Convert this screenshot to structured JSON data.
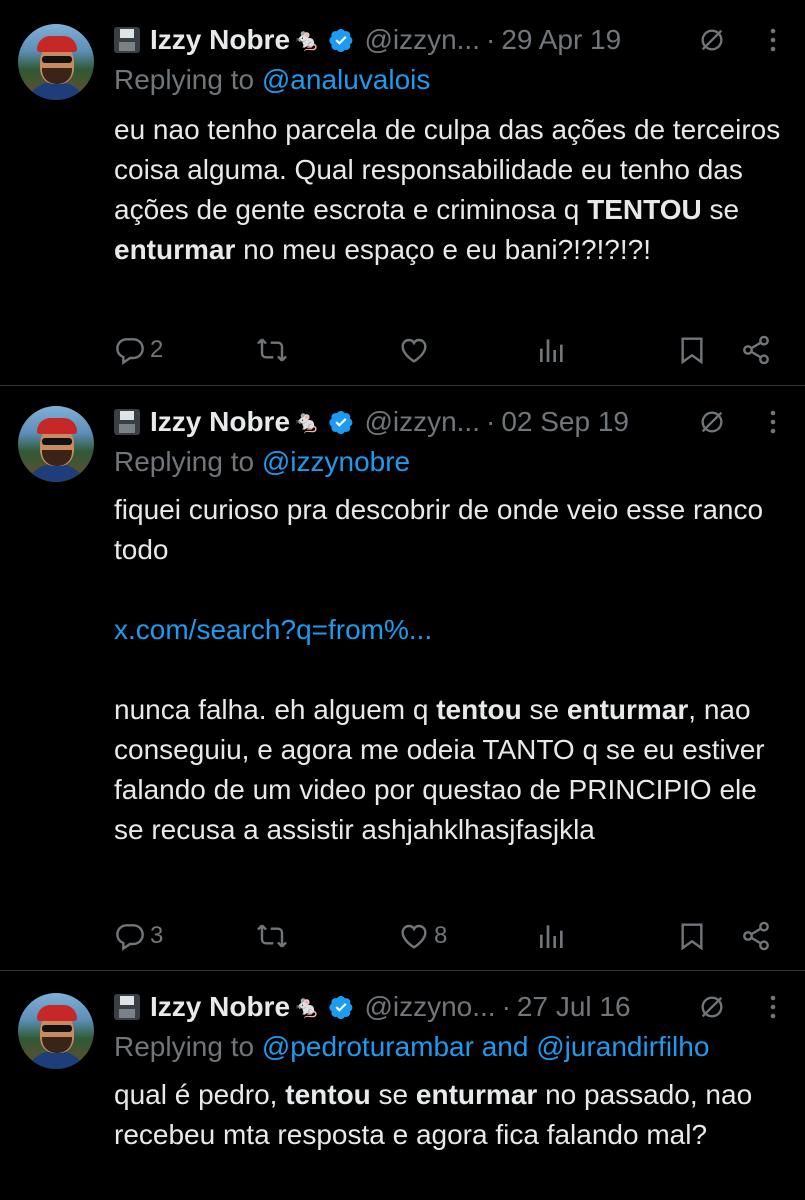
{
  "tweets": [
    {
      "author": {
        "name": "Izzy Nobre",
        "emoji": "🐁",
        "handle": "@izzyn..."
      },
      "date": "29 Apr 19",
      "replying_prefix": "Replying to ",
      "replying_to": "@analuvalois",
      "replying_joiner": "",
      "replying_to2": "",
      "text_parts": [
        {
          "t": "eu nao tenho parcela de culpa das ações de terceiros coisa alguma. Qual responsabilidade eu tenho das ações de gente escrota e criminosa q ",
          "b": false
        },
        {
          "t": "TENTOU",
          "b": true
        },
        {
          "t": " se ",
          "b": false
        },
        {
          "t": "enturmar",
          "b": true
        },
        {
          "t": " no meu espaço e eu bani?!?!?!?!",
          "b": false
        }
      ],
      "stats": {
        "replies": "2",
        "retweets": "",
        "likes": ""
      }
    },
    {
      "author": {
        "name": "Izzy Nobre",
        "emoji": "🐁",
        "handle": "@izzyn..."
      },
      "date": "02 Sep 19",
      "replying_prefix": "Replying to ",
      "replying_to": "@izzynobre",
      "replying_joiner": "",
      "replying_to2": "",
      "text1": "fiquei curioso pra descobrir de onde veio esse ranco todo",
      "link": "x.com/search?q=from%...",
      "text_parts": [
        {
          "t": "nunca falha. eh alguem q ",
          "b": false
        },
        {
          "t": "tentou",
          "b": true
        },
        {
          "t": " se ",
          "b": false
        },
        {
          "t": "enturmar",
          "b": true
        },
        {
          "t": ", nao conseguiu, e agora me odeia TANTO q se eu estiver falando de um video por questao de PRINCIPIO ele se recusa a assistir ashjahklhasjfasjkla",
          "b": false
        }
      ],
      "stats": {
        "replies": "3",
        "retweets": "",
        "likes": "8"
      }
    },
    {
      "author": {
        "name": "Izzy Nobre",
        "emoji": "🐁",
        "handle": "@izzyno..."
      },
      "date": "27 Jul 16",
      "replying_prefix": "Replying to ",
      "replying_to": "@pedroturambar",
      "replying_joiner": " and ",
      "replying_to2": "@jurandirfilho",
      "text_parts": [
        {
          "t": "qual é pedro, ",
          "b": false
        },
        {
          "t": "tentou",
          "b": true
        },
        {
          "t": " se ",
          "b": false
        },
        {
          "t": "enturmar",
          "b": true
        },
        {
          "t": " no passado, nao recebeu mta resposta e agora fica falando mal?",
          "b": false
        }
      ]
    }
  ],
  "separator": "·",
  "colors": {
    "background": "#000000",
    "text": "#e7e9ea",
    "muted": "#71767b",
    "accent": "#1d9bf0",
    "verified": "#1d9bf0",
    "divider": "#2f3336"
  },
  "icons": [
    "floppy-disk-emoji",
    "verified-badge-icon",
    "no-reply-icon",
    "more-icon",
    "reply-icon",
    "retweet-icon",
    "like-icon",
    "views-icon",
    "bookmark-icon",
    "share-icon"
  ]
}
